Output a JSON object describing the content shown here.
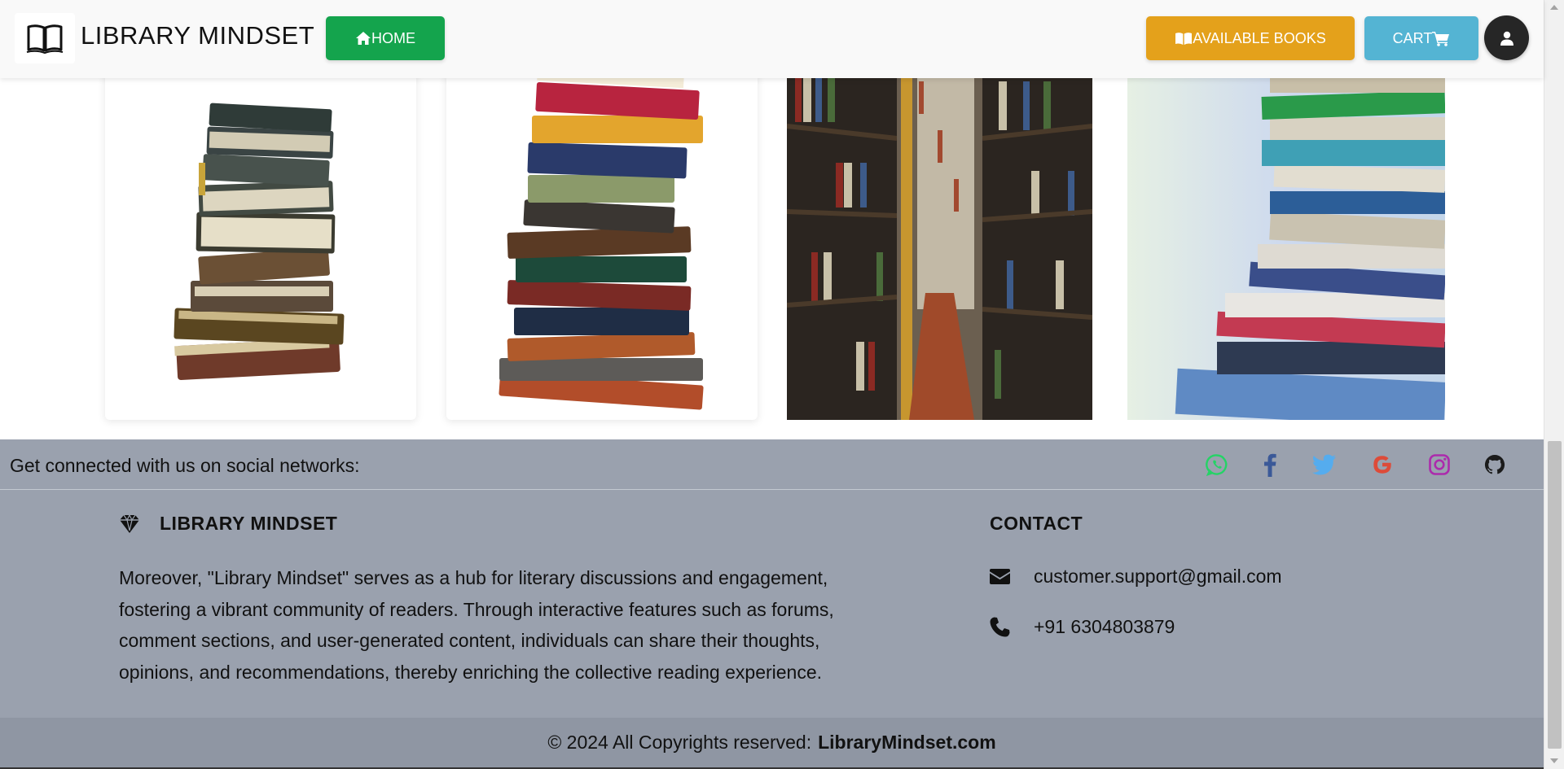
{
  "navbar": {
    "brand_name": "LIBRARY MINDSET",
    "home_label": "HOME",
    "books_label": "AVAILABLE BOOKS",
    "cart_label": "CART"
  },
  "icons": {
    "logo": "open-book-icon",
    "home": "home-icon",
    "books": "book-open-icon",
    "cart": "cart-icon",
    "user": "user-icon"
  },
  "gallery": [
    {
      "name": "stacked-old-books-image"
    },
    {
      "name": "stacked-colorful-books-image"
    },
    {
      "name": "library-aisle-image"
    },
    {
      "name": "books-on-table-image"
    }
  ],
  "footer": {
    "social_text": "Get connected with us on social networks:",
    "social_icons": [
      "whatsapp-icon",
      "facebook-icon",
      "twitter-icon",
      "google-icon",
      "instagram-icon",
      "github-icon"
    ],
    "about_title": "LIBRARY MINDSET",
    "about_text": "Moreover, \"Library Mindset\" serves as a hub for literary discussions and engagement, fostering a vibrant community of readers. Through interactive features such as forums, comment sections, and user-generated content, individuals can share their thoughts, opinions, and recommendations, thereby enriching the collective reading experience.",
    "contact_title": "CONTACT",
    "email": "customer.support@gmail.com",
    "phone": "+91 6304803879",
    "copyright_prefix": "© 2024 All Copyrights reserved:",
    "copyright_site": "LibraryMindset.com"
  },
  "colors": {
    "home_button": "#14a44d",
    "books_button": "#e4a11b",
    "cart_button": "#54b4d3",
    "footer_bg": "#9aa1ae",
    "copyright_bg": "#8f96a3"
  }
}
